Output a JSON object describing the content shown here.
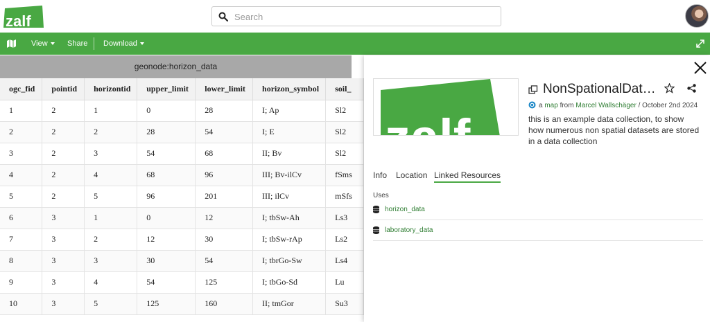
{
  "header": {
    "logo_text": "zalf",
    "search_placeholder": "Search"
  },
  "toolbar": {
    "view_label": "View",
    "share_label": "Share",
    "download_label": "Download"
  },
  "table": {
    "title": "geonode:horizon_data",
    "columns": [
      "ogc_fid",
      "pointid",
      "horizontid",
      "upper_limit",
      "lower_limit",
      "horizon_symbol",
      "soil_"
    ],
    "rows": [
      [
        "1",
        "2",
        "1",
        "0",
        "28",
        "I; Ap",
        "Sl2"
      ],
      [
        "2",
        "2",
        "2",
        "28",
        "54",
        "I; E",
        "Sl2"
      ],
      [
        "3",
        "2",
        "3",
        "54",
        "68",
        "II; Bv",
        "Sl2"
      ],
      [
        "4",
        "2",
        "4",
        "68",
        "96",
        "III; Bv-ilCv",
        "fSms"
      ],
      [
        "5",
        "2",
        "5",
        "96",
        "201",
        "III; ilCv",
        "mSfs"
      ],
      [
        "6",
        "3",
        "1",
        "0",
        "12",
        "I; tbSw-Ah",
        "Ls3"
      ],
      [
        "7",
        "3",
        "2",
        "12",
        "30",
        "I; tbSw-rAp",
        "Ls2"
      ],
      [
        "8",
        "3",
        "3",
        "30",
        "54",
        "I; tbrGo-Sw",
        "Ls4"
      ],
      [
        "9",
        "3",
        "4",
        "54",
        "125",
        "I; tbGo-Sd",
        "Lu"
      ],
      [
        "10",
        "3",
        "5",
        "125",
        "160",
        "II; tmGor",
        "Su3"
      ]
    ]
  },
  "panel": {
    "thumb_text": "zalf",
    "title": "NonSpationalData…",
    "meta_prefix": "a",
    "meta_type": "map",
    "meta_from": "from",
    "meta_author": "Marcel Wallschäger",
    "meta_date": "/ October 2nd 2024",
    "description": "this is an example data collection, to show how numerous non spatial datasets are stored in a data collection",
    "tabs": [
      "Info",
      "Location",
      "Linked Resources"
    ],
    "active_tab": "Linked Resources",
    "uses_label": "Uses",
    "linked": [
      "horizon_data",
      "laboratory_data"
    ]
  },
  "colors": {
    "brand_green": "#49a843",
    "link_green": "#2e7d32",
    "title_bar_gray": "#a8a8a8"
  },
  "icons": [
    "search-icon",
    "map-icon",
    "expand-icon",
    "close-icon",
    "copy-icon",
    "star-icon",
    "share-icon",
    "globe-icon",
    "database-icon"
  ]
}
